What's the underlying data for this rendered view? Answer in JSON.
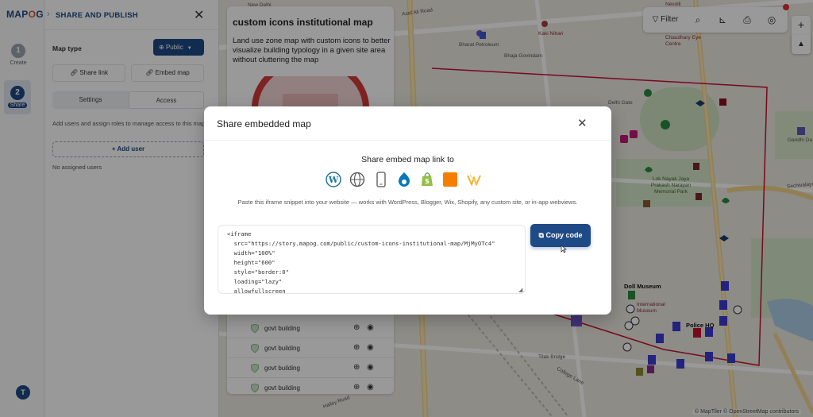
{
  "brand": {
    "logo_text_a": "MAP",
    "logo_text_pin": "O",
    "logo_text_b": "G"
  },
  "rail": {
    "steps": [
      {
        "num": "1",
        "label": "Create"
      },
      {
        "num": "2",
        "label": "Share"
      }
    ],
    "help_label": "T"
  },
  "panel": {
    "title": "SHARE AND PUBLISH",
    "map_type_label": "Map type",
    "map_type_value": "Public",
    "share_link_label": "Share link",
    "embed_map_label": "Embed map",
    "tabs": [
      "Settings",
      "Access"
    ],
    "active_tab": "Access",
    "access_description": "Add users and assign roles to manage access to this map.",
    "add_user_label": "+ Add user",
    "no_users_label": "No assigned users"
  },
  "story": {
    "title": "custom icons institutional map",
    "description": "Land use zone map with custom icons to better visualize building typology in a given site area without cluttering the map",
    "list_items": [
      "govt building",
      "govt building",
      "govt building",
      "govt building"
    ]
  },
  "map": {
    "filter_label": "Filter",
    "labels": {
      "new_delhi": "New Delhi",
      "asaf_ali": "Asaf Ali Road",
      "bharat": "Bharat Petroleum",
      "kaki": "Kaki Nihari",
      "bhaja": "Bhaja Govindam",
      "nerolli": "Nevolli",
      "chaudhary": "Chaudhary Eye Centre",
      "delhi_gate": "Delhi Gate",
      "gandhi": "Gandhi Da",
      "sechivalaya": "Sechivalaya",
      "lok_nayak": "Lok Nayak Jaya Prakash Narayan Memorial Park",
      "doll": "Doll Museum",
      "intl": "International Museum",
      "police": "Police HQ",
      "tilak": "Tilak Bridge",
      "college": "College Lane",
      "hailey": "Hailey Road"
    },
    "attribution": "© MapTiler © OpenStreetMap contributors"
  },
  "modal": {
    "title": "Share embedded map",
    "share_to_label": "Share embed map link to",
    "platforms": [
      "wordpress-icon",
      "web-icon",
      "mobile-icon",
      "drupal-icon",
      "shopify-icon",
      "blogger-icon",
      "wix-icon"
    ],
    "paste_note": "Paste this iframe snippet into your website — works with WordPress, Blogger, Wix, Shopify, any custom site, or in-app webviews.",
    "code_lines": [
      "<iframe",
      "  src=\"https://story.mapog.com/public/custom-icons-institutional-map/MjMyOTc4\"",
      "  width=\"100%\"",
      "  height=\"600\"",
      "  style=\"border:0\"",
      "  loading=\"lazy\"",
      "  allowfullscreen"
    ],
    "copy_button_label": "Copy code"
  },
  "colors": {
    "brand_blue": "#1e4a86",
    "accent_orange": "#e8582a",
    "boundary_red": "#c8102e"
  }
}
